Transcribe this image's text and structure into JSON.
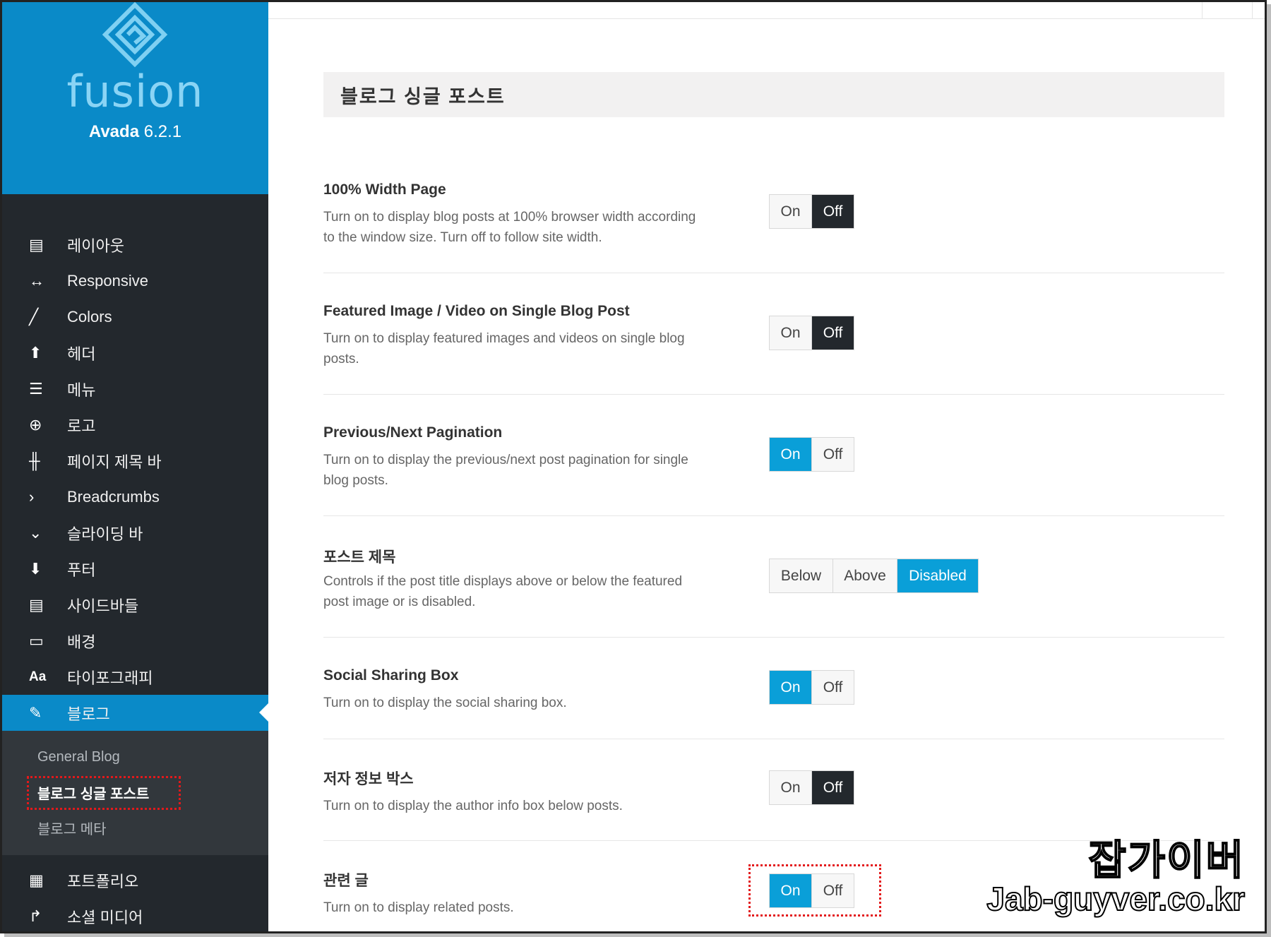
{
  "brand": {
    "product": "fusion",
    "name": "Avada",
    "version": "6.2.1"
  },
  "sidebar": {
    "items": [
      {
        "label": "레이아웃",
        "icon": "layout-icon"
      },
      {
        "label": "Responsive",
        "icon": "arrows-horizontal-icon"
      },
      {
        "label": "Colors",
        "icon": "brush-icon"
      },
      {
        "label": "헤더",
        "icon": "arrow-up-icon"
      },
      {
        "label": "메뉴",
        "icon": "menu-icon"
      },
      {
        "label": "로고",
        "icon": "plus-circle-icon"
      },
      {
        "label": "페이지 제목 바",
        "icon": "sliders-icon"
      },
      {
        "label": "Breadcrumbs",
        "icon": "chevron-right-icon"
      },
      {
        "label": "슬라이딩 바",
        "icon": "chevron-down-icon"
      },
      {
        "label": "푸터",
        "icon": "arrow-down-icon"
      },
      {
        "label": "사이드바들",
        "icon": "sidebar-icon"
      },
      {
        "label": "배경",
        "icon": "background-icon"
      },
      {
        "label": "타이포그래피",
        "icon": "typography-icon"
      },
      {
        "label": "블로그",
        "icon": "edit-icon"
      }
    ],
    "sub_items": [
      {
        "label": "General Blog"
      },
      {
        "label": "블로그 싱글 포스트"
      },
      {
        "label": "블로그 메타"
      }
    ],
    "items2": [
      {
        "label": "포트폴리오",
        "icon": "grid-icon"
      },
      {
        "label": "소셜 미디어",
        "icon": "share-icon"
      }
    ]
  },
  "main": {
    "section_title": "블로그 싱글 포스트",
    "options": [
      {
        "label": "100% Width Page",
        "desc1": "Turn on to display blog posts at 100% browser width according",
        "desc2": "to the window size. Turn off to follow site width.",
        "choices": [
          "On",
          "Off"
        ],
        "selected": "Off"
      },
      {
        "label": "Featured Image / Video on Single Blog Post",
        "desc1": "Turn on to display featured images and videos on single blog",
        "desc2": "posts.",
        "choices": [
          "On",
          "Off"
        ],
        "selected": "Off"
      },
      {
        "label": "Previous/Next Pagination",
        "desc1": "Turn on to display the previous/next post pagination for single",
        "desc2": "blog posts.",
        "choices": [
          "On",
          "Off"
        ],
        "selected": "On"
      },
      {
        "label": "포스트 제목",
        "desc1": "Controls if the post title displays above or below the featured",
        "desc2": "post image or is disabled.",
        "choices": [
          "Below",
          "Above",
          "Disabled"
        ],
        "selected": "Disabled"
      },
      {
        "label": "Social Sharing Box",
        "desc1": "Turn on to display the social sharing box.",
        "desc2": "",
        "choices": [
          "On",
          "Off"
        ],
        "selected": "On"
      },
      {
        "label": "저자 정보 박스",
        "desc1": "Turn on to display the author info box below posts.",
        "desc2": "",
        "choices": [
          "On",
          "Off"
        ],
        "selected": "Off"
      },
      {
        "label": "관련 글",
        "desc1": "Turn on to display related posts.",
        "desc2": "",
        "choices": [
          "On",
          "Off"
        ],
        "selected": "On"
      }
    ]
  },
  "watermark": {
    "line1": "잡가이버",
    "line2": "Jab-guyver.co.kr"
  },
  "colors": {
    "accent": "#0a8ac8",
    "toggle_on": "#0a9fd8",
    "sidebar_bg": "#23282d",
    "highlight": "#e3191b"
  }
}
